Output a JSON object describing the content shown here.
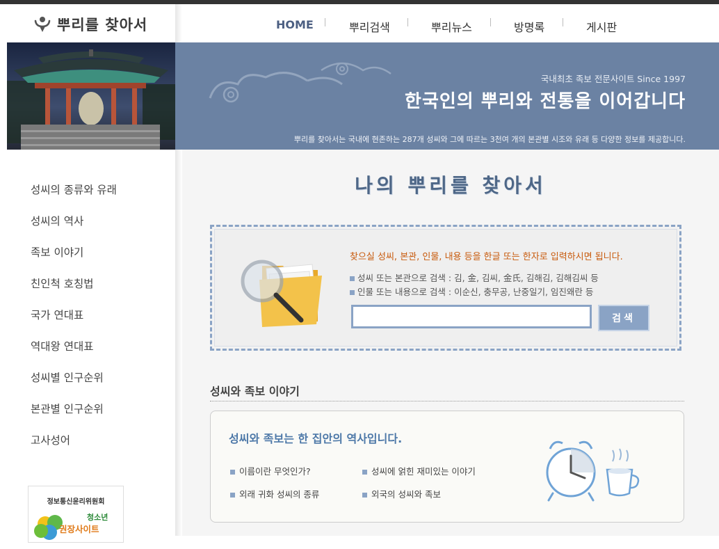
{
  "site": {
    "logo_text": "뿌리를 찾아서"
  },
  "topnav": [
    {
      "label": "HOME",
      "active": true
    },
    {
      "label": "뿌리검색"
    },
    {
      "label": "뿌리뉴스"
    },
    {
      "label": "방명록"
    },
    {
      "label": "게시판"
    }
  ],
  "banner": {
    "since": "국내최초 족보 전문사이트 Since 1997",
    "title": "한국인의 뿌리와 전통을 이어갑니다",
    "desc": "뿌리를 찾아서는 국내에 현존하는 287개 성씨와 그에 따르는 3천여 개의 본관별 시조와 유래 등 다양한 정보를 제공합니다."
  },
  "sidenav": [
    "성씨의 종류와 유래",
    "성씨의 역사",
    "족보 이야기",
    "친인척 호칭법",
    "국가 연대표",
    "역대왕 연대표",
    "성씨별 인구순위",
    "본관별 인구순위",
    "고사성어"
  ],
  "badge": {
    "title": "정보통신윤리위원회",
    "sub": "청소년 권장사이트"
  },
  "main": {
    "heading": "나의 뿌리를 찾아서",
    "search": {
      "instruction": "찾으실 성씨, 본관, 인물, 내용 등을 한글 또는 한자로 입력하시면 됩니다.",
      "example1": "성씨 또는 본관으로 검색 : 김, 金, 김씨, 金氏, 김해김, 김해김씨 등",
      "example2": "인물 또는 내용으로 검색 : 이순신, 충무공, 난중일기, 임진왜란 등",
      "input_value": "",
      "button": "검색"
    },
    "section_title": "성씨와 족보 이야기",
    "story": {
      "title": "성씨와 족보는 한 집안의 역사입니다.",
      "links": [
        "이름이란 무엇인가?",
        "성씨에 얽힌 재미있는 이야기",
        "외래 귀화 성씨의 종류",
        "외국의 성씨와 족보"
      ]
    }
  },
  "colors": {
    "accent": "#8aa3c5",
    "banner": "#6b82a3",
    "instruction": "#c85a0c",
    "story_title": "#4d78a8"
  },
  "icons": [
    "logo-person-icon",
    "magnifier-folder-icon",
    "alarm-clock-icon",
    "coffee-cup-icon",
    "clover-icon"
  ]
}
